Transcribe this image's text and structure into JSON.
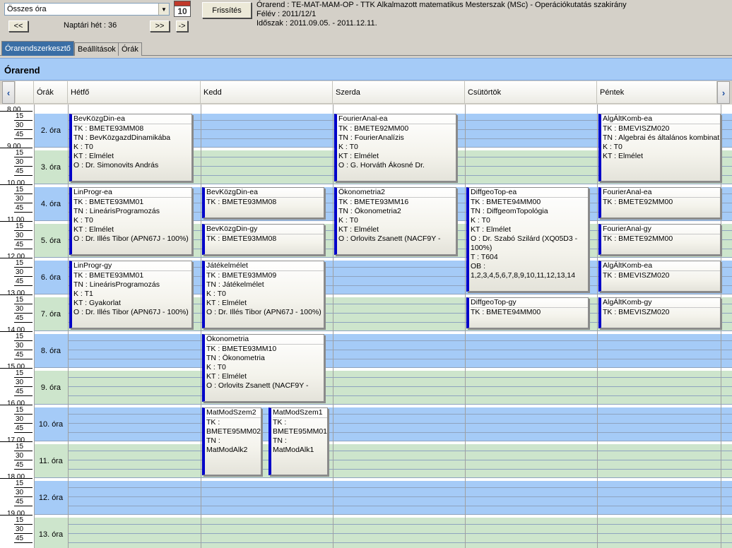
{
  "top": {
    "filter_value": "Összes óra",
    "calendar_day": "10",
    "refresh_label": "Frissítés",
    "prev_label": "<<",
    "next_label": ">>",
    "jump_label": "->",
    "week_label": "Naptári hét : 36",
    "info_line1": "Órarend : TE-MAT-MAM-OP - TTK Alkalmazott matematikus Mesterszak (MSc) - Operációkutatás szakirány",
    "info_line2": "Félév : 2011/12/1",
    "info_line3": "Időszak : 2011.09.05. - 2011.12.11."
  },
  "tabs": [
    "Órarendszerkesztő",
    "Beállítások",
    "Órák"
  ],
  "panel_title": "Órarend",
  "columns": {
    "hours": "Órák",
    "days": [
      "Hétfő",
      "Kedd",
      "Szerda",
      "Csütörtök",
      "Péntek"
    ]
  },
  "times": {
    "hours": [
      "8 00",
      "9 00",
      "10 00",
      "11 00",
      "12 00",
      "13 00",
      "14 00",
      "15 00",
      "16 00",
      "17 00",
      "18 00",
      "19 00"
    ],
    "minutes": [
      "15",
      "30",
      "45"
    ]
  },
  "slots": [
    "2. óra",
    "3. óra",
    "4. óra",
    "5. óra",
    "6. óra",
    "7. óra",
    "8. óra",
    "9. óra",
    "10. óra",
    "11. óra",
    "12. óra",
    "13. óra"
  ],
  "colors": {
    "blue_row": "#a5cbf7",
    "green_row": "#cde5cc",
    "accent": "#0000c8"
  },
  "events": [
    {
      "day": 0,
      "start": 0,
      "end": 2,
      "lines": [
        "BevKözgDin-ea",
        "TK : BMETE93MM08",
        "TN : BevKözgazdDinamikába",
        "K : T0",
        "KT : Elmélet",
        "O :  Dr. Simonovits András"
      ]
    },
    {
      "day": 0,
      "start": 2,
      "end": 4,
      "lines": [
        "LinProgr-ea",
        "TK : BMETE93MM01",
        "TN : LineárisProgramozás",
        "K : T0",
        "KT : Elmélet",
        "O :  Dr. Illés Tibor (APN67J - 100%)"
      ]
    },
    {
      "day": 0,
      "start": 4,
      "end": 6,
      "lines": [
        "LinProgr-gy",
        "TK : BMETE93MM01",
        "TN : LineárisProgramozás",
        "K : T1",
        "KT : Gyakorlat",
        "O :  Dr. Illés Tibor (APN67J - 100%)"
      ]
    },
    {
      "day": 1,
      "start": 2,
      "end": 3,
      "lines": [
        "BevKözgDin-ea",
        "TK : BMETE93MM08"
      ]
    },
    {
      "day": 1,
      "start": 3,
      "end": 4,
      "lines": [
        "BevKözgDin-gy",
        "TK : BMETE93MM08"
      ]
    },
    {
      "day": 1,
      "start": 4,
      "end": 6,
      "lines": [
        "Játékelmélet",
        "TK : BMETE93MM09",
        "TN : Játékelmélet",
        "K : T0",
        "KT : Elmélet",
        "O :  Dr. Illés Tibor (APN67J - 100%)"
      ]
    },
    {
      "day": 1,
      "start": 6,
      "end": 8,
      "lines": [
        "Ökonometria",
        "TK : BMETE93MM10",
        "TN : Ökonometria",
        "K : T0",
        "KT : Elmélet",
        "O :  Orlovits Zsanett (NACF9Y -"
      ]
    },
    {
      "day": 1,
      "start": 8,
      "end": 10,
      "half": 0,
      "wrap": true,
      "lines": [
        "MatModSzem2",
        "TK : BMETE95MM02",
        "TN : MatModAlk2"
      ]
    },
    {
      "day": 1,
      "start": 8,
      "end": 10,
      "half": 1,
      "wrap": true,
      "lines": [
        "MatModSzem1",
        "TK : BMETE95MM01",
        "TN : MatModAlk1"
      ]
    },
    {
      "day": 2,
      "start": 0,
      "end": 2,
      "lines": [
        "FourierAnal-ea",
        "TK : BMETE92MM00",
        "TN : FourierAnalízis",
        "K : T0",
        "KT : Elmélet",
        "O :  G. Horváth Ákosné Dr."
      ]
    },
    {
      "day": 2,
      "start": 2,
      "end": 4,
      "lines": [
        "Ökonometria2",
        "TK : BMETE93MM16",
        "TN : Ökonometria2",
        "K : T0",
        "KT : Elmélet",
        "O :  Orlovits Zsanett (NACF9Y -"
      ]
    },
    {
      "day": 3,
      "start": 2,
      "end": 5,
      "wrap": true,
      "lines": [
        "DiffgeoTop-ea",
        "TK : BMETE94MM00",
        "TN : DiffgeomTopológia",
        "K : T0",
        "KT : Elmélet",
        "O :  Dr. Szabó Szilárd (XQ05D3 - 100%)",
        "T : T604",
        "OB : 1,2,3,4,5,6,7,8,9,10,11,12,13,14"
      ]
    },
    {
      "day": 3,
      "start": 5,
      "end": 6,
      "lines": [
        "DiffgeoTop-gy",
        "TK : BMETE94MM00"
      ]
    },
    {
      "day": 4,
      "start": 0,
      "end": 2,
      "wrap": true,
      "lines": [
        "AlgÁltKomb-ea",
        "TK : BMEVISZM020",
        "TN : Algebrai és általános kombinat",
        "K : T0",
        "KT : Elmélet"
      ]
    },
    {
      "day": 4,
      "start": 2,
      "end": 3,
      "lines": [
        "FourierAnal-ea",
        "TK : BMETE92MM00"
      ]
    },
    {
      "day": 4,
      "start": 3,
      "end": 4,
      "lines": [
        "FourierAnal-gy",
        "TK : BMETE92MM00"
      ]
    },
    {
      "day": 4,
      "start": 4,
      "end": 5,
      "lines": [
        "AlgÁltKomb-ea",
        "TK : BMEVISZM020"
      ]
    },
    {
      "day": 4,
      "start": 5,
      "end": 6,
      "lines": [
        "AlgÁltKomb-gy",
        "TK : BMEVISZM020"
      ]
    }
  ]
}
